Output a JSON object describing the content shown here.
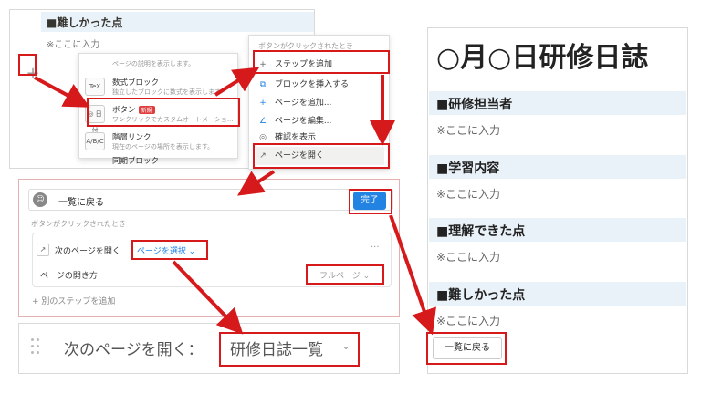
{
  "panel1": {
    "heading": "■難しかった点",
    "placeholder": "※ここに入力",
    "plus": "+",
    "menu_items": [
      {
        "icon": "",
        "title": "",
        "desc": "ページの説明を表示します。"
      },
      {
        "icon": "TeX",
        "title": "数式ブロック",
        "desc": "独立したブロックに数式を表示します"
      },
      {
        "icon": "◎ 日付",
        "title": "ボタン",
        "badge": "新規",
        "desc": "ワンクリックでカスタムオートメーショ..."
      },
      {
        "icon": "A/B/C",
        "title": "階層リンク",
        "desc": "現在のページの場所を表示します。"
      },
      {
        "icon": "",
        "title": "同期ブロック",
        "desc": ""
      }
    ],
    "menu2_header": "ボタンがクリックされたとき",
    "menu2_items": [
      {
        "icon": "+",
        "label": "ステップを追加"
      },
      {
        "icon": "⧉",
        "label": "ブロックを挿入する"
      },
      {
        "icon": "+",
        "label": "ページを追加..."
      },
      {
        "icon": "∠",
        "label": "ページを編集..."
      },
      {
        "icon": "◎",
        "label": "確認を表示"
      },
      {
        "icon": "↗",
        "label": "ページを開く"
      }
    ]
  },
  "panel2": {
    "emoji": "☺",
    "button_name": "一覧に戻る",
    "done_label": "完了",
    "trigger_label": "ボタンがクリックされたとき",
    "action_icon": "↗",
    "action_label": "次のページを開く",
    "select_page": "ページを選択 ⌄",
    "dots": "···",
    "open_mode_label": "ページの開き方",
    "open_mode_value": "フルページ ⌄",
    "add_step": "+ 別のステップを追加"
  },
  "panel3": {
    "label": "次のページを開く：",
    "value": "研修日誌一覧",
    "chevron": "⌄"
  },
  "panel4": {
    "title": "○月○日研修日誌",
    "sections": [
      {
        "heading": "■研修担当者",
        "placeholder": "※ここに入力"
      },
      {
        "heading": "■学習内容",
        "placeholder": "※ここに入力"
      },
      {
        "heading": "■理解できた点",
        "placeholder": "※ここに入力"
      },
      {
        "heading": "■難しかった点",
        "placeholder": "※ここに入力"
      }
    ],
    "back_button": "一覧に戻る"
  },
  "colors": {
    "highlight_red": "#d6191b",
    "accent_blue": "#2383e2",
    "heading_bg": "#eaf2f9"
  }
}
